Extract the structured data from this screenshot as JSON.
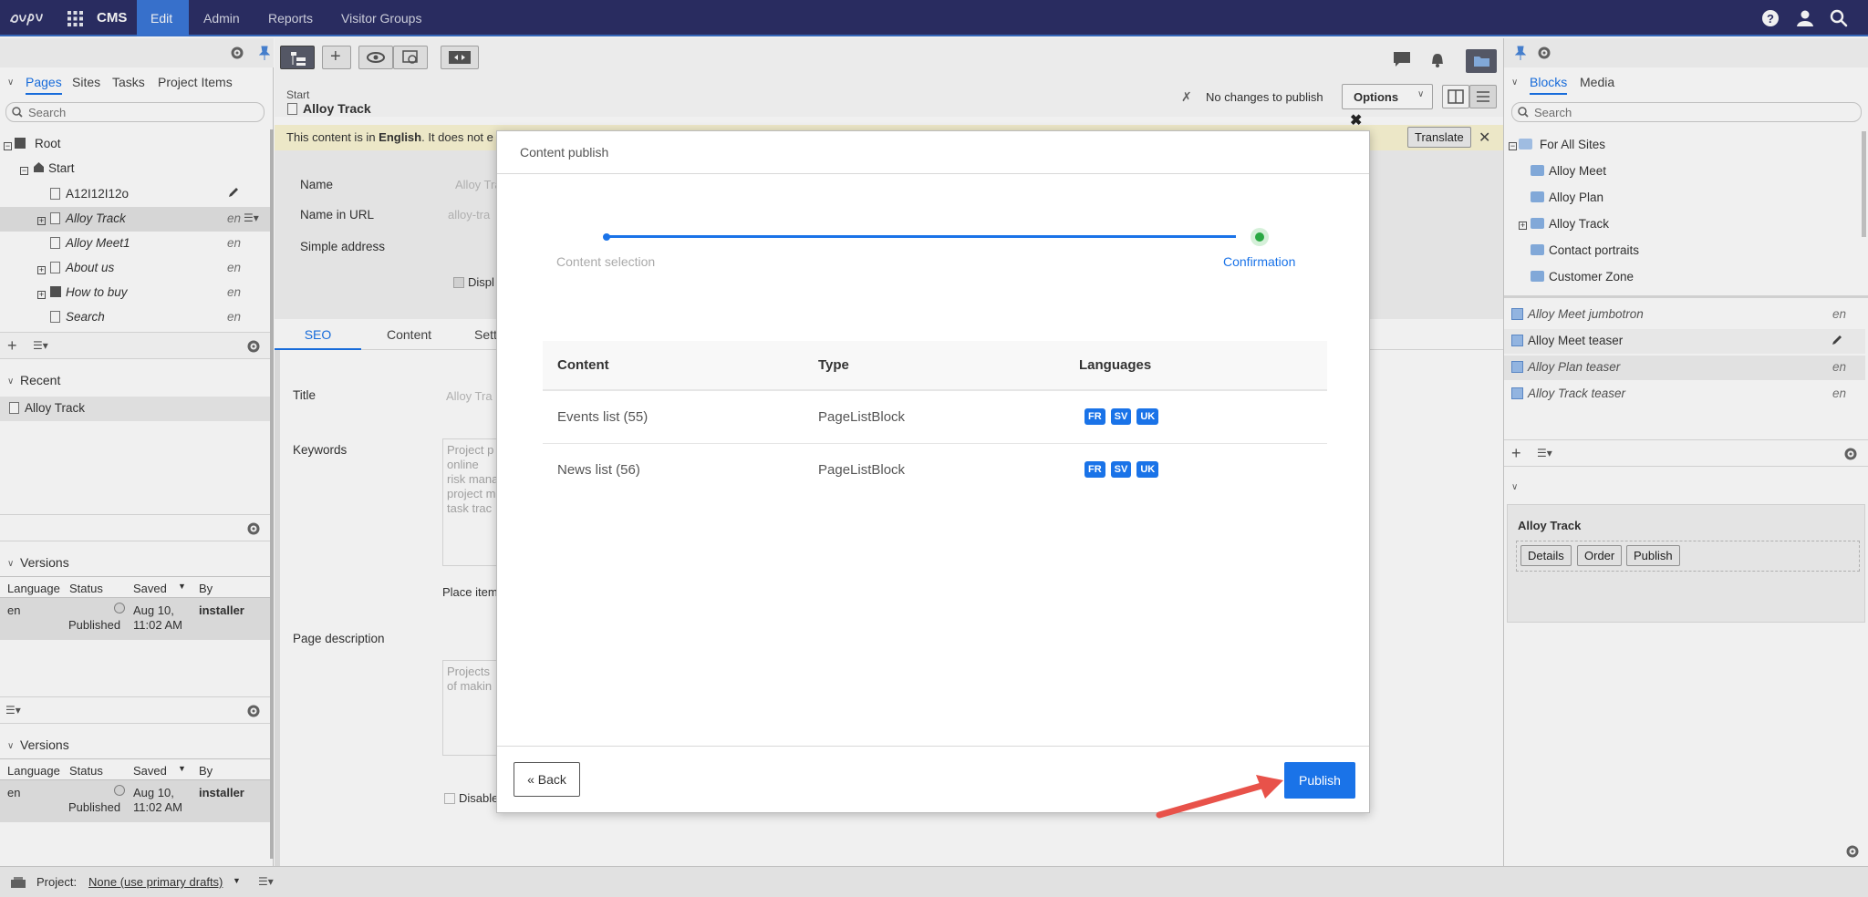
{
  "nav": {
    "cms": "CMS",
    "items": [
      "Edit",
      "Admin",
      "Reports",
      "Visitor Groups"
    ]
  },
  "left": {
    "tabs": [
      "Pages",
      "Sites",
      "Tasks",
      "Project Items"
    ],
    "search_placeholder": "Search",
    "tree": [
      {
        "label": "Root",
        "lang": ""
      },
      {
        "label": "Start",
        "lang": ""
      },
      {
        "label": "A12I12I12o",
        "lang": ""
      },
      {
        "label": "Alloy Track",
        "lang": "en"
      },
      {
        "label": "Alloy Meet1",
        "lang": "en"
      },
      {
        "label": "About us",
        "lang": "en"
      },
      {
        "label": "How to buy",
        "lang": "en"
      },
      {
        "label": "Search",
        "lang": "en"
      }
    ],
    "recent_title": "Recent",
    "recent_items": [
      "Alloy Track"
    ],
    "versions_title": "Versions",
    "versions_headers": [
      "Language",
      "Status",
      "Saved",
      "By"
    ],
    "versions_row": {
      "lang": "en",
      "status": "Published",
      "saved1": "Aug 10,",
      "saved2": "11:02 AM",
      "by": "installer"
    }
  },
  "editor": {
    "breadcrumb": "Start",
    "page_title": "Alloy Track",
    "no_changes": "No changes to publish",
    "options": "Options",
    "notice_pre": "This content is in ",
    "notice_lang": "English",
    "notice_post": ". It does not e",
    "translate": "Translate",
    "fields": {
      "name_label": "Name",
      "name_value": "Alloy Tra",
      "url_label": "Name in URL",
      "url_value": "alloy-tra",
      "simple_label": "Simple address",
      "display_label": "Displ"
    },
    "tabs": [
      "SEO",
      "Content",
      "Sett"
    ],
    "seo": {
      "title_label": "Title",
      "title_value": "Alloy Tra",
      "keywords_label": "Keywords",
      "keywords_lines": [
        "Project p",
        "online",
        "risk mana",
        "project m",
        "task trac"
      ],
      "place_item": "Place item",
      "desc_label": "Page description",
      "desc_lines": [
        "Projects",
        "of makin"
      ],
      "disable": "Disable"
    }
  },
  "right": {
    "tabs": [
      "Blocks",
      "Media"
    ],
    "search_placeholder": "Search",
    "folders": [
      "For All Sites",
      "Alloy Meet",
      "Alloy Plan",
      "Alloy Track",
      "Contact portraits",
      "Customer Zone"
    ],
    "blocks": [
      {
        "label": "Alloy Meet jumbotron",
        "lang": "en"
      },
      {
        "label": "Alloy Meet teaser",
        "lang": ""
      },
      {
        "label": "Alloy Plan teaser",
        "lang": "en"
      },
      {
        "label": "Alloy Track teaser",
        "lang": "en"
      }
    ],
    "panel_title": "Alloy Track",
    "panel_buttons": [
      "Details",
      "Order",
      "Publish"
    ]
  },
  "footer": {
    "project_label": "Project:",
    "project_value": "None (use primary drafts)"
  },
  "dialog": {
    "title": "Content publish",
    "step1": "Content selection",
    "step2": "Confirmation",
    "headers": [
      "Content",
      "Type",
      "Languages"
    ],
    "rows": [
      {
        "content": "Events list (55)",
        "type": "PageListBlock",
        "langs": [
          "FR",
          "SV",
          "UK"
        ]
      },
      {
        "content": "News list (56)",
        "type": "PageListBlock",
        "langs": [
          "FR",
          "SV",
          "UK"
        ]
      }
    ],
    "back": "« Back",
    "publish": "Publish",
    "accent": "#1a73e8",
    "arrow_color": "#e8524a"
  }
}
